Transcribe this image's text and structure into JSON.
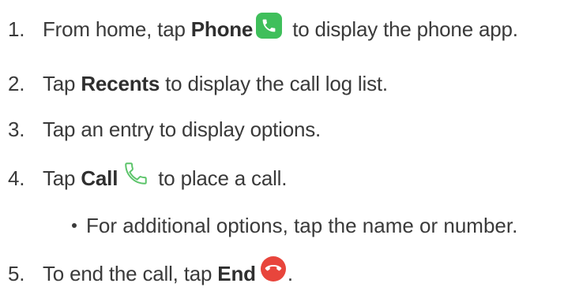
{
  "steps": [
    {
      "number": "1.",
      "pre": "From home, tap ",
      "bold": "Phone",
      "icon": "phone-app-icon",
      "post": " to display the phone app."
    },
    {
      "number": "2.",
      "pre": "Tap ",
      "bold": "Recents",
      "post": " to display the call log list."
    },
    {
      "number": "3.",
      "text": "Tap an entry to display options."
    },
    {
      "number": "4.",
      "pre": "Tap ",
      "bold": "Call",
      "icon": "call-handset-icon",
      "post": " to place a call."
    },
    {
      "number": "5.",
      "pre": "To end the call, tap ",
      "bold": "End",
      "icon": "end-call-icon",
      "post": "."
    }
  ],
  "substep": {
    "text": "For additional options, tap the name or number."
  },
  "colors": {
    "text": "#3a3a3a",
    "phone_icon_bg": "#3fbf5b",
    "call_icon": "#5cc46a",
    "end_icon_bg": "#e8453c"
  }
}
